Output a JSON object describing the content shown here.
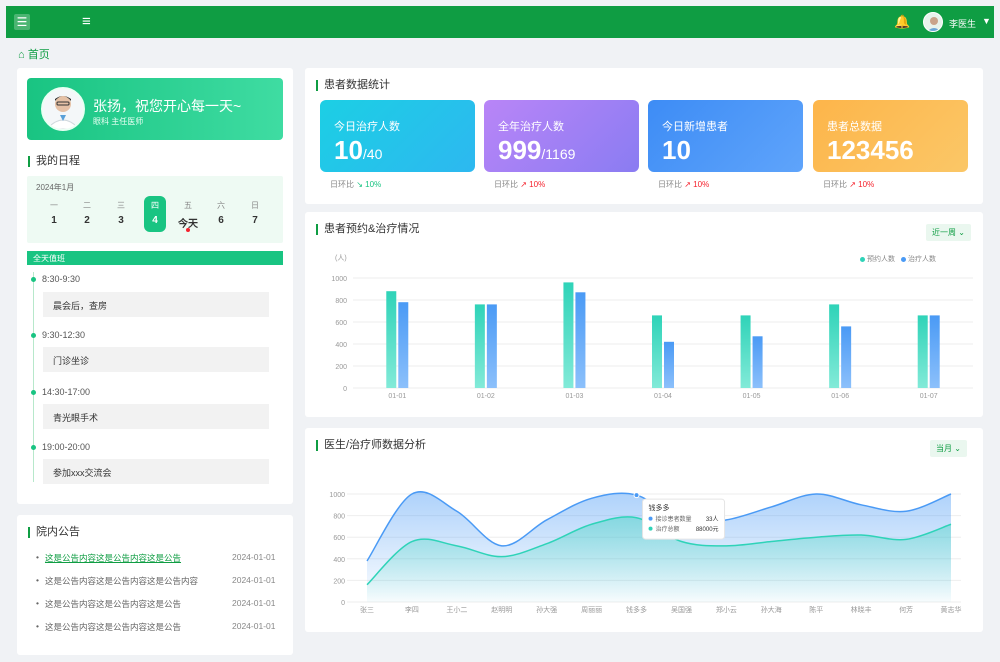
{
  "header": {
    "username": "李医生",
    "menu_icon": "menu-icon",
    "fold_icon": "fold-icon",
    "bell_icon": "bell-icon"
  },
  "breadcrumb": {
    "home": "首页"
  },
  "welcome": {
    "greeting": "张扬，祝您开心每一天~",
    "subtitle": "眼科 主任医师"
  },
  "schedule": {
    "title": "我的日程",
    "month": "2024年1月",
    "days": [
      {
        "weekday": "一",
        "date": "1"
      },
      {
        "weekday": "二",
        "date": "2"
      },
      {
        "weekday": "三",
        "date": "3"
      },
      {
        "weekday": "四",
        "date": "4"
      },
      {
        "weekday": "五",
        "date": "今天"
      },
      {
        "weekday": "六",
        "date": "6"
      },
      {
        "weekday": "日",
        "date": "7"
      }
    ],
    "all_day": "全天值班",
    "events": [
      {
        "time": "8:30-9:30",
        "title": "晨会后，查房"
      },
      {
        "time": "9:30-12:30",
        "title": "门诊坐诊"
      },
      {
        "time": "14:30-17:00",
        "title": "青光眼手术"
      },
      {
        "time": "19:00-20:00",
        "title": "参加xxx交流会"
      }
    ]
  },
  "notices": {
    "title": "院内公告",
    "items": [
      {
        "text": "这是公告内容这是公告内容这是公告",
        "date": "2024-01-01"
      },
      {
        "text": "这是公告内容这是公告内容这是公告内容",
        "date": "2024-01-01"
      },
      {
        "text": "这是公告内容这是公告内容这是公告",
        "date": "2024-01-01"
      },
      {
        "text": "这是公告内容这是公告内容这是公告",
        "date": "2024-01-01"
      }
    ]
  },
  "stats": {
    "title": "患者数据统计",
    "compare_label": "日环比",
    "cards": [
      {
        "label": "今日治疗人数",
        "value": "10",
        "suffix": "/40",
        "change": "10%",
        "trend": "down",
        "color_from": "#1ccfe4",
        "color_to": "#2db8f0"
      },
      {
        "label": "全年治疗人数",
        "value": "999",
        "suffix": "/1169",
        "change": "10%",
        "trend": "up",
        "color_from": "#b985f7",
        "color_to": "#8a7cf2"
      },
      {
        "label": "今日新增患者",
        "value": "10",
        "suffix": "",
        "change": "10%",
        "trend": "up",
        "color_from": "#3d8cf5",
        "color_to": "#5fa4fb"
      },
      {
        "label": "患者总数据",
        "value": "123456",
        "suffix": "",
        "change": "10%",
        "trend": "up",
        "color_from": "#fdb54a",
        "color_to": "#fbc767"
      }
    ]
  },
  "appointments": {
    "title": "患者预约&治疗情况",
    "range": "近一周",
    "chart_data": {
      "type": "bar",
      "ylabel": "(人)",
      "ylim": [
        0,
        1000
      ],
      "yticks": [
        0,
        200,
        400,
        600,
        800,
        1000
      ],
      "categories": [
        "01-01",
        "01-02",
        "01-03",
        "01-04",
        "01-05",
        "01-06",
        "01-07"
      ],
      "series": [
        {
          "name": "预约人数",
          "values": [
            880,
            760,
            960,
            660,
            660,
            760,
            660
          ],
          "color": "#2fd3b8"
        },
        {
          "name": "治疗人数",
          "values": [
            780,
            760,
            870,
            420,
            470,
            560,
            660
          ],
          "color": "#4a9af5"
        }
      ],
      "grid": true,
      "legend": "top-right"
    }
  },
  "doctor_analysis": {
    "title": "医生/治疗师数据分析",
    "range": "当月",
    "tooltip": {
      "name": "钱多多",
      "rows": [
        {
          "label": "接诊患者数量",
          "value": "33人"
        },
        {
          "label": "治疗总额",
          "value": "88000元"
        }
      ]
    },
    "chart_data": {
      "type": "area",
      "ylim": [
        0,
        1000
      ],
      "yticks": [
        0,
        200,
        400,
        600,
        800,
        1000
      ],
      "categories": [
        "张三",
        "李四",
        "王小二",
        "赵明明",
        "孙大强",
        "周丽丽",
        "钱多多",
        "吴国强",
        "郑小云",
        "孙大海",
        "陈平",
        "林晓丰",
        "何芳",
        "黄志华"
      ],
      "series": [
        {
          "name": "接诊患者数量",
          "values": [
            380,
            1000,
            840,
            520,
            760,
            960,
            990,
            740,
            760,
            880,
            1000,
            900,
            840,
            1000
          ],
          "color": "#4a9af5"
        },
        {
          "name": "治疗总额",
          "values": [
            160,
            560,
            520,
            420,
            540,
            720,
            780,
            560,
            520,
            560,
            600,
            620,
            580,
            720
          ],
          "color": "#2fd3b8"
        }
      ],
      "grid": true
    }
  }
}
